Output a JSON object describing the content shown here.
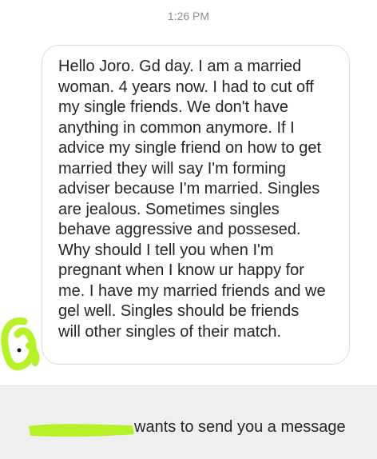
{
  "header": {
    "time": "1:26 PM"
  },
  "message": {
    "text": "Hello Joro. Gd day. I am a married\nwoman. 4 years now. I had to cut off\nmy single friends. We don't have\nanything in common anymore. If I\nadvice my single friend on how to get\nmarried they will say I'm forming\nadviser because I'm married. Singles\nare jealous. Sometimes singles\nbehave aggressive and possesed.\nWhy should I tell you when I'm\npregnant when I know ur happy for\nme. I have my married friends and we\ngel well. Singles should be friends\nwill other singles of their match."
  },
  "request_bar": {
    "text": "wants to send you a message"
  },
  "colors": {
    "highlighter": "#b6f227",
    "bubble_border": "#dcdcdc",
    "text": "#262626",
    "timestamp": "#8e8e8e",
    "bottom_bar": "#efefef"
  }
}
